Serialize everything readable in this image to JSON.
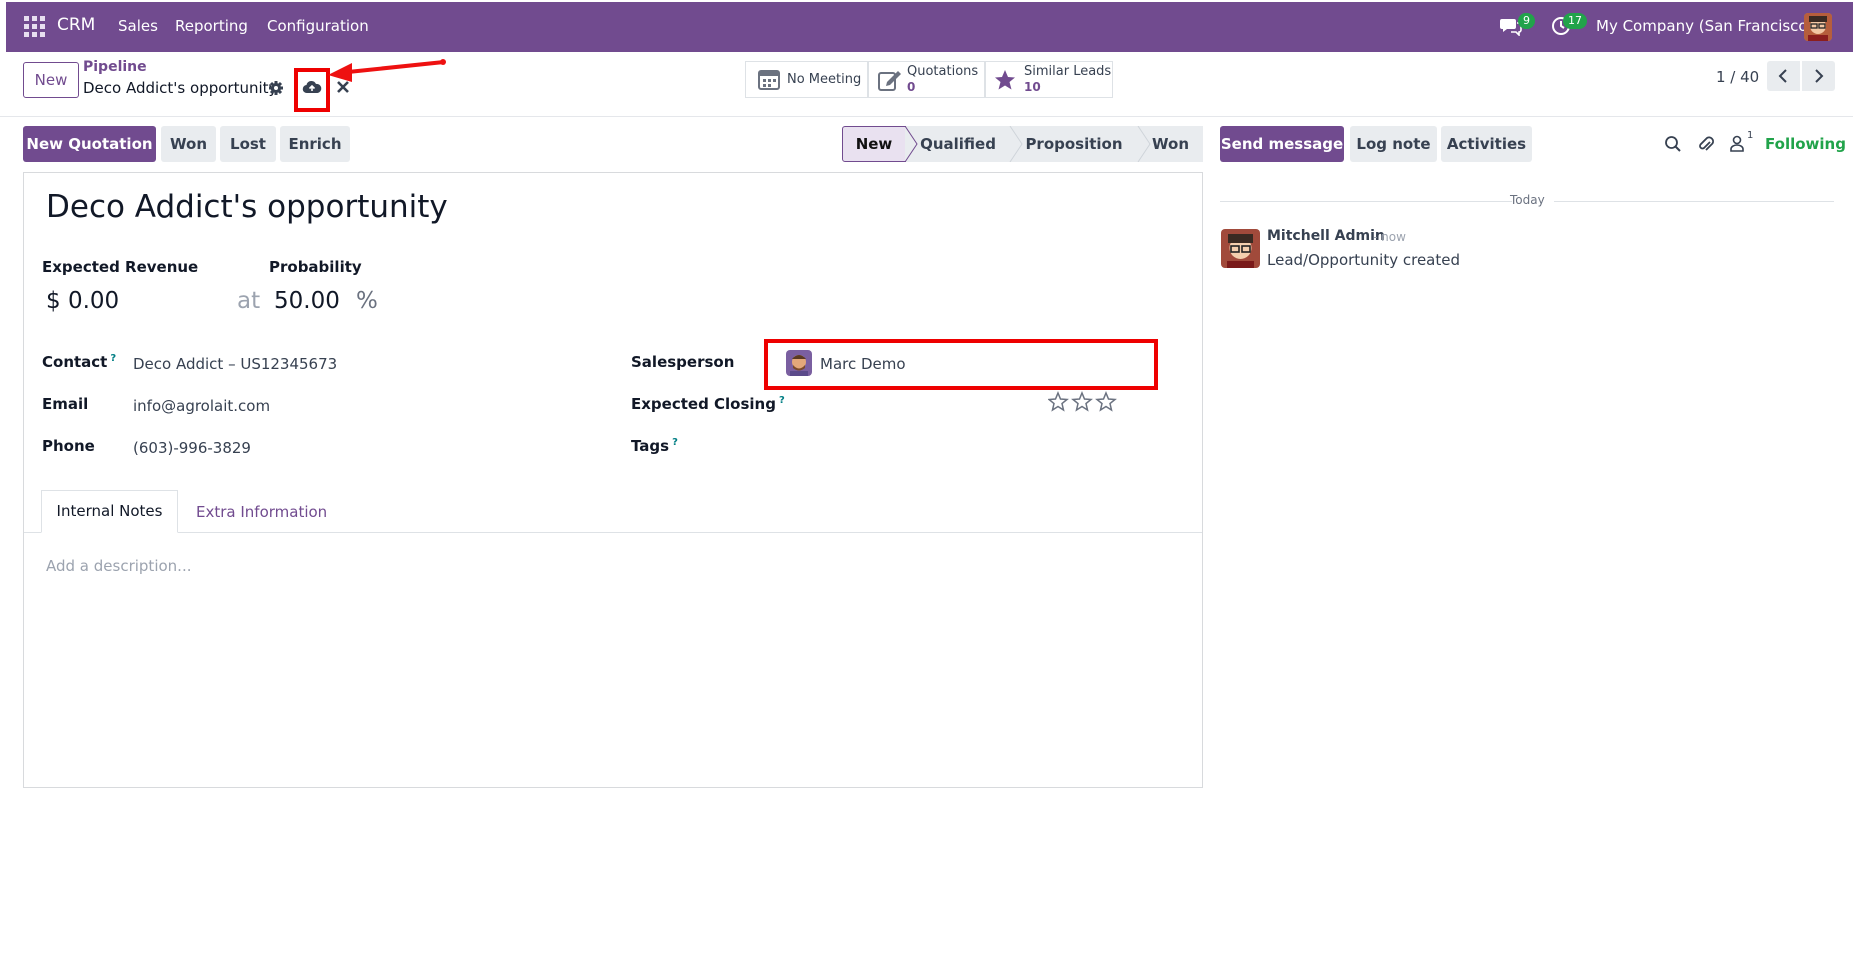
{
  "navbar": {
    "app_name": "CRM",
    "menu": [
      "Sales",
      "Reporting",
      "Configuration"
    ],
    "messages_count": "9",
    "activities_count": "17",
    "company": "My Company (San Francisco)"
  },
  "control": {
    "new_button": "New",
    "breadcrumb_parent": "Pipeline",
    "record_name": "Deco Addict's opportunity",
    "pager": "1 / 40",
    "stats": [
      {
        "label": "No Meeting",
        "count": ""
      },
      {
        "label": "Quotations",
        "count": "0"
      },
      {
        "label": "Similar Leads",
        "count": "10"
      }
    ]
  },
  "actions": {
    "new_quotation": "New Quotation",
    "won": "Won",
    "lost": "Lost",
    "enrich": "Enrich"
  },
  "stages": [
    "New",
    "Qualified",
    "Proposition",
    "Won"
  ],
  "form": {
    "title": "Deco Addict's opportunity",
    "expected_revenue_label": "Expected Revenue",
    "expected_revenue": "$ 0.00",
    "at": "at",
    "probability_label": "Probability",
    "probability": "50.00",
    "percent": "%",
    "contact_label": "Contact",
    "contact": "Deco Addict – US12345673",
    "email_label": "Email",
    "email": "info@agrolait.com",
    "phone_label": "Phone",
    "phone": "(603)-996-3829",
    "salesperson_label": "Salesperson",
    "salesperson": "Marc Demo",
    "expected_closing_label": "Expected Closing",
    "tags_label": "Tags",
    "priority_stars": 0,
    "tabs": [
      "Internal Notes",
      "Extra Information"
    ],
    "description_placeholder": "Add a description..."
  },
  "chatter": {
    "send_message": "Send message",
    "log_note": "Log note",
    "activities": "Activities",
    "followers_count": "1",
    "following": "Following",
    "date_separator": "Today",
    "message_author": "Mitchell Admin",
    "message_time": "- now",
    "message_body": "Lead/Opportunity created"
  },
  "colors": {
    "brand": "#714B8F",
    "highlight": "#ee0000",
    "following": "#21a34a"
  }
}
